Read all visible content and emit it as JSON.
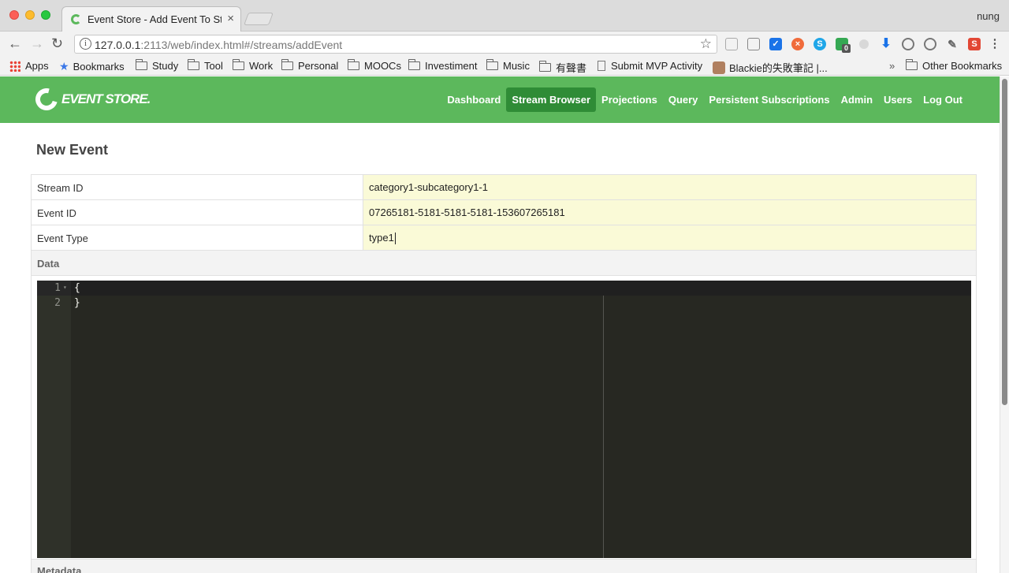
{
  "browser": {
    "tab_title": "Event Store - Add Event To Str",
    "profile_name": "nung",
    "url_host": "127.0.0.1",
    "url_rest": ":2113/web/index.html#/streams/addEvent",
    "bookmarks": [
      {
        "label": "Apps",
        "icon": "apps-grid-icon"
      },
      {
        "label": "Bookmarks",
        "icon": "star-icon"
      },
      {
        "label": "Study",
        "icon": "folder-icon"
      },
      {
        "label": "Tool",
        "icon": "folder-icon"
      },
      {
        "label": "Work",
        "icon": "folder-icon"
      },
      {
        "label": "Personal",
        "icon": "folder-icon"
      },
      {
        "label": "MOOCs",
        "icon": "folder-icon"
      },
      {
        "label": "Investiment",
        "icon": "folder-icon"
      },
      {
        "label": "Music",
        "icon": "folder-icon"
      },
      {
        "label": "有聲書",
        "icon": "folder-icon"
      },
      {
        "label": "Submit MVP Activity",
        "icon": "document-icon"
      },
      {
        "label": "Blackie的失敗筆記 |...",
        "icon": "avatar-icon"
      }
    ],
    "overflow_label": "»",
    "other_bookmarks": "Other Bookmarks",
    "extension_badge": "0"
  },
  "app": {
    "logo_text": "EVENT STORE.",
    "nav": [
      {
        "label": "Dashboard",
        "active": false
      },
      {
        "label": "Stream Browser",
        "active": true
      },
      {
        "label": "Projections",
        "active": false
      },
      {
        "label": "Query",
        "active": false
      },
      {
        "label": "Persistent Subscriptions",
        "active": false
      },
      {
        "label": "Admin",
        "active": false
      },
      {
        "label": "Users",
        "active": false
      },
      {
        "label": "Log Out",
        "active": false
      }
    ],
    "accent_color": "#5cb85c",
    "active_nav_color": "#2f8c36"
  },
  "form": {
    "title": "New Event",
    "stream_id_label": "Stream ID",
    "stream_id_value": "category1-subcategory1-1",
    "event_id_label": "Event ID",
    "event_id_value": "07265181-5181-5181-5181-153607265181",
    "event_type_label": "Event Type",
    "event_type_value": "type1",
    "data_label": "Data",
    "editor_lines": [
      {
        "number": "1",
        "text": "{"
      },
      {
        "number": "2",
        "text": "}"
      }
    ],
    "metadata_label": "Metadata"
  }
}
